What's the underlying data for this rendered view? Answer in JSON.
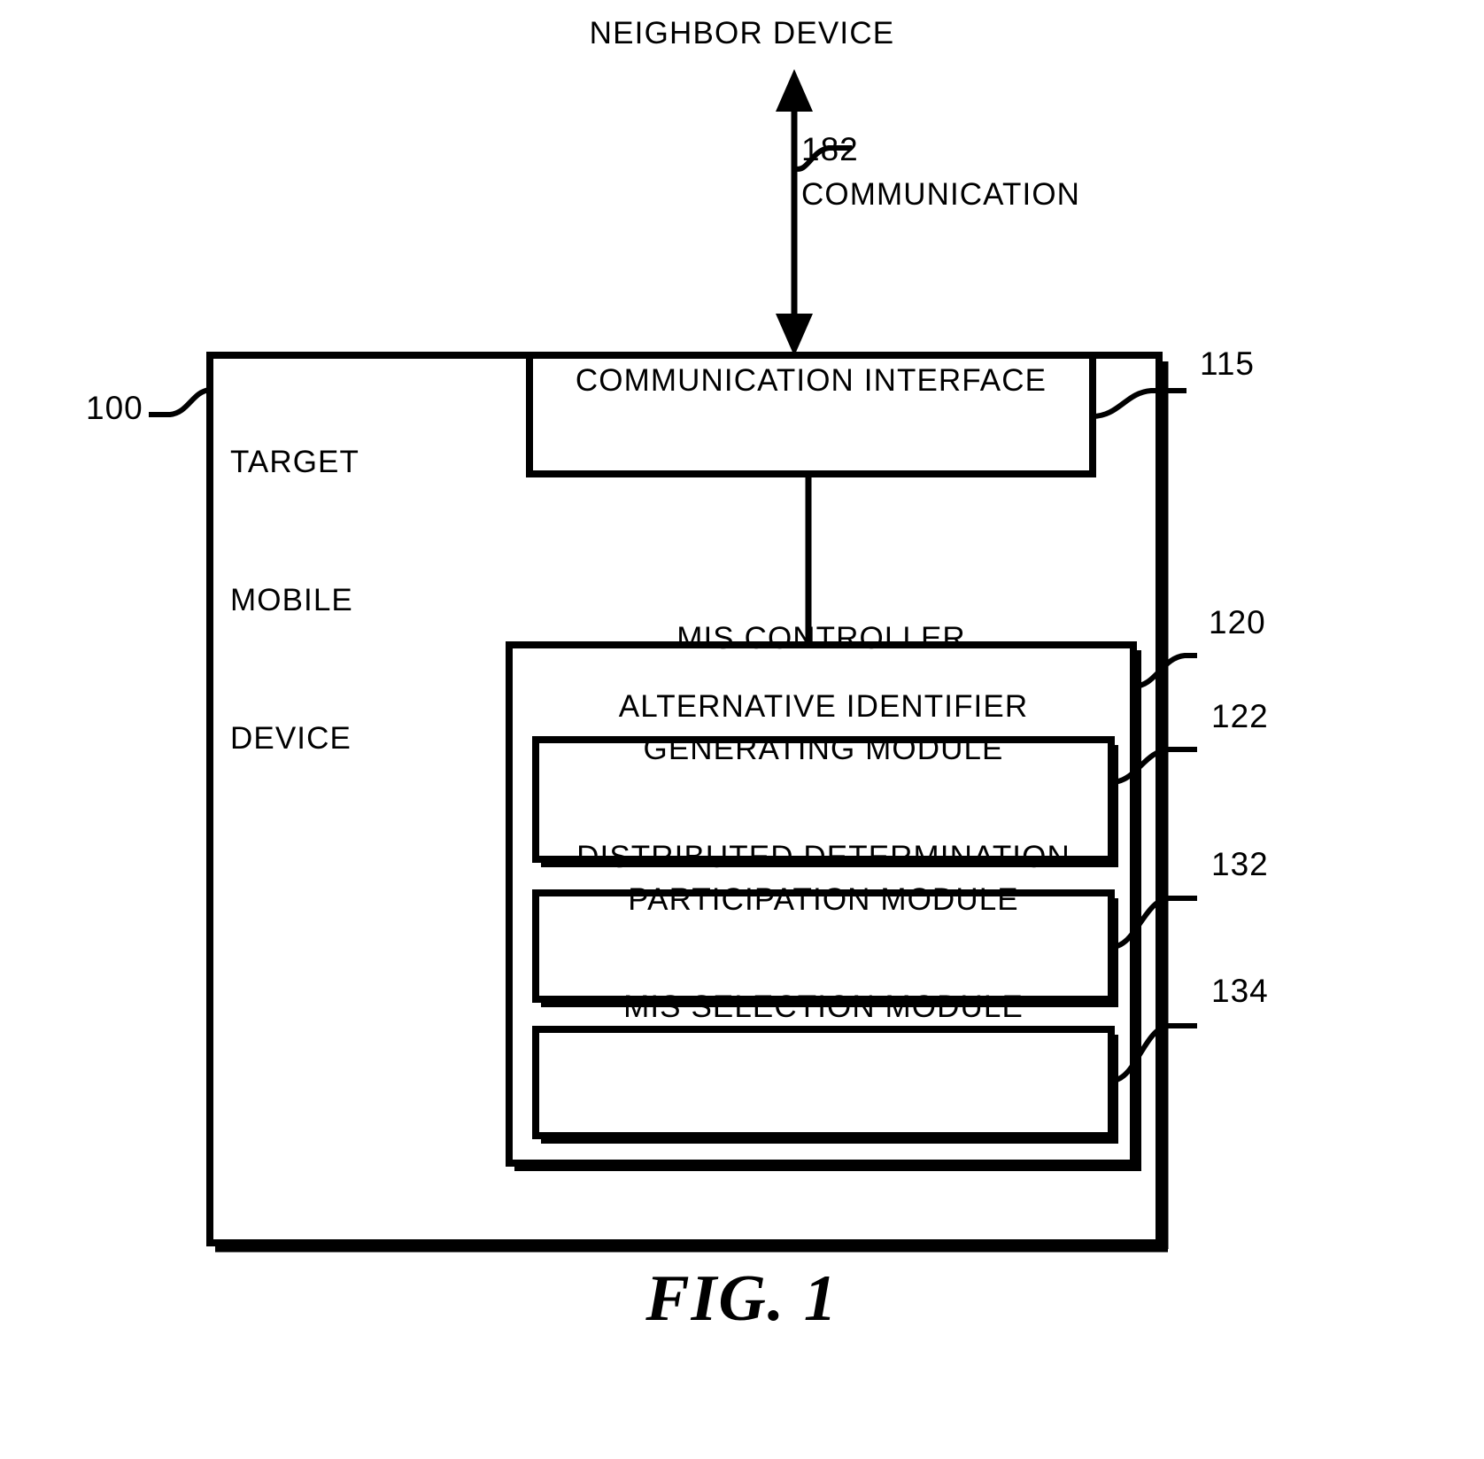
{
  "figure": {
    "caption": "FIG. 1",
    "external_label": "NEIGHBOR DEVICE",
    "link": {
      "ref": "182",
      "label": "COMMUNICATION"
    },
    "device": {
      "ref": "100",
      "title_line_1": "TARGET",
      "title_line_2": "MOBILE",
      "title_line_3": "DEVICE"
    },
    "blocks": [
      {
        "ref": "115",
        "label": "COMMUNICATION INTERFACE",
        "name": "communication-interface"
      },
      {
        "ref": "120",
        "label": "MIS CONTROLLER",
        "name": "mis-controller"
      },
      {
        "ref": "122",
        "label_line_1": "ALTERNATIVE IDENTIFIER",
        "label_line_2": "GENERATING MODULE",
        "name": "alternative-identifier-generating-module"
      },
      {
        "ref": "132",
        "label_line_1": "DISTRIBUTED DETERMINATION",
        "label_line_2": "PARTICIPATION MODULE",
        "name": "distributed-determination-participation-module"
      },
      {
        "ref": "134",
        "label_line_1": "MIS SELECTION MODULE",
        "label_line_2": "",
        "name": "mis-selection-module"
      }
    ],
    "colors": {
      "ink": "#000000",
      "background": "#ffffff"
    }
  }
}
